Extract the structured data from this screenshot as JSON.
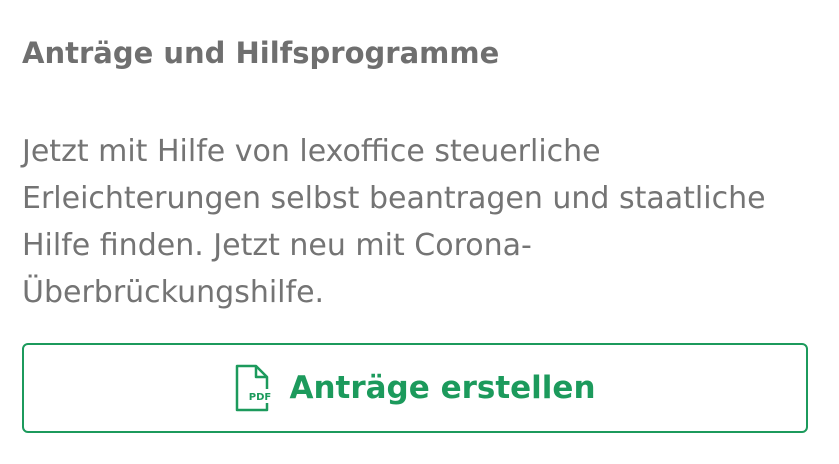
{
  "card": {
    "title": "Anträge und Hilfsprogramme",
    "description": "Jetzt mit Hilfe von lexoffice steuerliche Erleichterungen selbst beantragen und staatliche Hilfe finden. Jetzt neu mit Corona-Überbrückungshilfe.",
    "button": {
      "label": "Anträge erstellen",
      "icon": "pdf-document-icon",
      "icon_text": "PDF"
    }
  },
  "colors": {
    "accent": "#1c9a5c",
    "title_text": "#6f6f6f",
    "body_text": "#747474",
    "background": "#ffffff"
  }
}
